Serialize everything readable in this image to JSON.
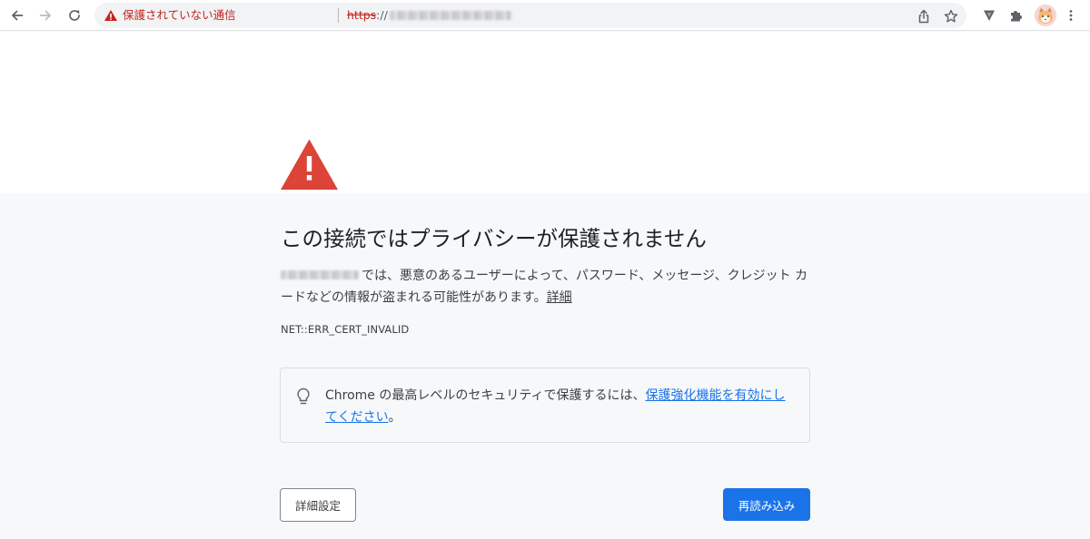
{
  "toolbar": {
    "back_icon": "arrow-left-icon",
    "forward_icon": "arrow-right-icon",
    "reload_icon": "reload-icon",
    "omnibox": {
      "security_status": "保護されていない通信",
      "url_scheme": "https",
      "url_slashes": "://"
    },
    "share_icon": "share-icon",
    "bookmark_icon": "star-icon",
    "extensions": [
      "vivaldi-extension-icon",
      "puzzle-icon"
    ],
    "menu_icon": "kebab-menu-icon"
  },
  "page": {
    "heading": "この接続ではプライバシーが保護されません",
    "body_text": "では、悪意のあるユーザーによって、パスワード、メッセージ、クレジット カードなどの情報が盗まれる可能性があります。",
    "details_link": "詳細",
    "error_code": "NET::ERR_CERT_INVALID",
    "tip": {
      "text_before": "Chrome の最高レベルのセキュリティで保護するには、",
      "link": "保護強化機能を有効にしてください",
      "text_after": "。"
    },
    "advanced_button": "詳細設定",
    "reload_button": "再読み込み"
  },
  "colors": {
    "warning_red": "#c5221f",
    "triangle_red": "#db4437",
    "primary_blue": "#1a73e8",
    "link_blue": "#1a73e8",
    "page_background": "#f7f8fa"
  }
}
